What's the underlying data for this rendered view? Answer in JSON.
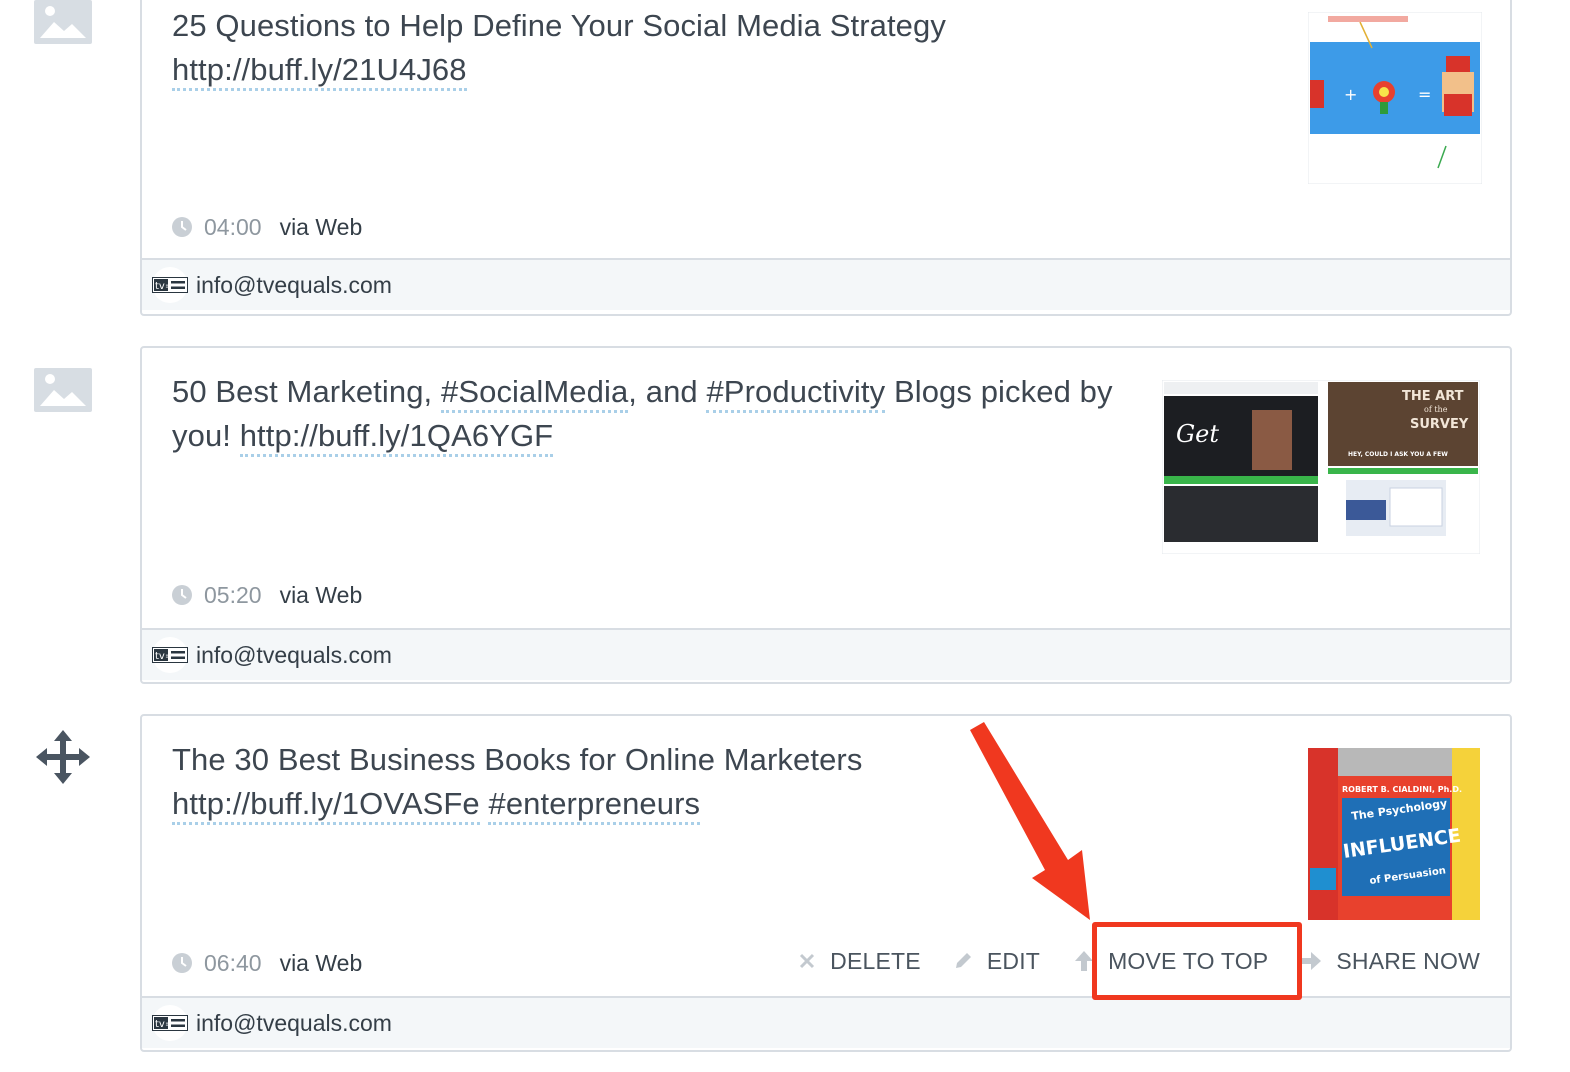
{
  "posts": [
    {
      "parts": [
        {
          "text": "25 Questions to Help Define Your Social Media Strategy ",
          "link": false
        },
        {
          "text": "http://buff.ly/21U4J68",
          "link": true
        }
      ],
      "time": "04:00",
      "via": "via Web",
      "account": "info@tvequals.com",
      "side_icon": "image-placeholder-icon"
    },
    {
      "parts": [
        {
          "text": "50 Best Marketing, ",
          "link": false
        },
        {
          "text": "#SocialMedia",
          "link": true
        },
        {
          "text": ", and ",
          "link": false
        },
        {
          "text": "#Productivity",
          "link": true
        },
        {
          "text": " Blogs picked by you! ",
          "link": false
        },
        {
          "text": "http://buff.ly/1QA6YGF",
          "link": true
        }
      ],
      "time": "05:20",
      "via": "via Web",
      "account": "info@tvequals.com",
      "side_icon": "image-placeholder-icon",
      "thumb_labels": [
        "THE ART",
        "of the",
        "SURVEY",
        "HEY, COULD I ASK YOU A FEW"
      ]
    },
    {
      "parts": [
        {
          "text": "The 30 Best Business Books for Online Marketers ",
          "link": false
        },
        {
          "text": "http://buff.ly/1OVASFe",
          "link": true
        },
        {
          "text": " ",
          "link": false
        },
        {
          "text": "#enterpreneurs",
          "link": true
        }
      ],
      "time": "06:40",
      "via": "via Web",
      "account": "info@tvequals.com",
      "side_icon": "drag-move-icon",
      "thumb_labels": [
        "ROBERT B. CIALDINI, Ph.D.",
        "The Psychology",
        "INFLUENCE",
        "of Persuasion"
      ]
    }
  ],
  "account_logo_text": "tv=",
  "actions": {
    "delete": "DELETE",
    "edit": "EDIT",
    "move_to_top": "MOVE TO TOP",
    "share_now": "SHARE NOW"
  },
  "colors": {
    "text": "#3d4650",
    "link_underline": "#a9cfe8",
    "card_border": "#d8dde3",
    "footer_bg": "#f4f7f9",
    "annotation": "#f0381f",
    "muted": "#8e979f"
  }
}
